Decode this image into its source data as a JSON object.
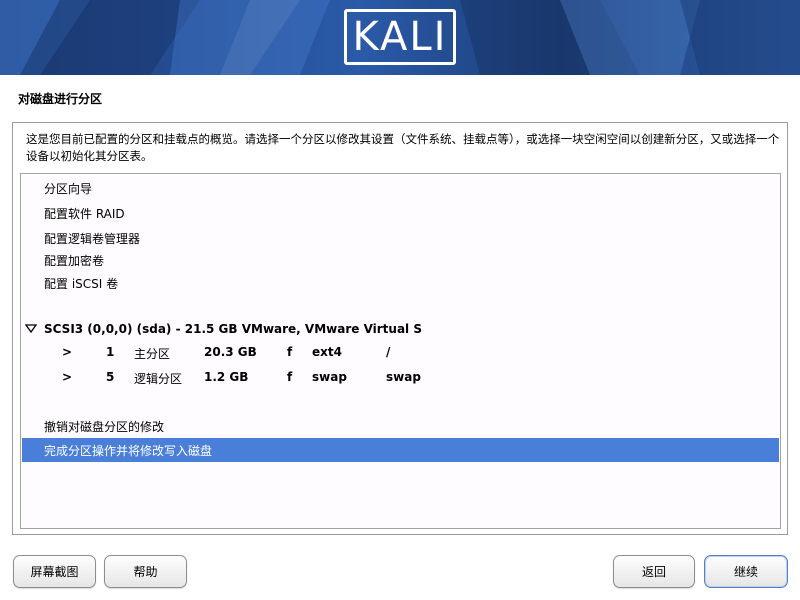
{
  "banner": {
    "logo_text": "KALI"
  },
  "page": {
    "title": "对磁盘进行分区",
    "instruction": "这是您目前已配置的分区和挂载点的概览。请选择一个分区以修改其设置（文件系统、挂载点等），或选择一块空闲空间以创建新分区，又或选择一个设备以初始化其分区表。"
  },
  "list": {
    "actions": [
      {
        "label": "分区向导"
      },
      {
        "label": "配置软件 RAID"
      },
      {
        "label": "配置逻辑卷管理器"
      },
      {
        "label": "配置加密卷"
      },
      {
        "label": "配置 iSCSI 卷"
      }
    ],
    "disk": {
      "label": "SCSI3 (0,0,0) (sda) - 21.5 GB VMware, VMware Virtual S"
    },
    "partitions": [
      {
        "arrow": ">",
        "number": "1",
        "type": "主分区",
        "size": "20.3 GB",
        "flag": "f",
        "fs": "ext4",
        "mount": "/"
      },
      {
        "arrow": ">",
        "number": "5",
        "type": "逻辑分区",
        "size": "1.2 GB",
        "flag": "f",
        "fs": "swap",
        "mount": "swap"
      }
    ],
    "undo": {
      "label": "撤销对磁盘分区的修改"
    },
    "finish": {
      "label": "完成分区操作并将修改写入磁盘"
    }
  },
  "buttons": {
    "screenshot": "屏幕截图",
    "help": "帮助",
    "back": "返回",
    "continue": "继续"
  },
  "colors": {
    "selection": "#4a7fd9",
    "banner": "#2a5aa8"
  }
}
